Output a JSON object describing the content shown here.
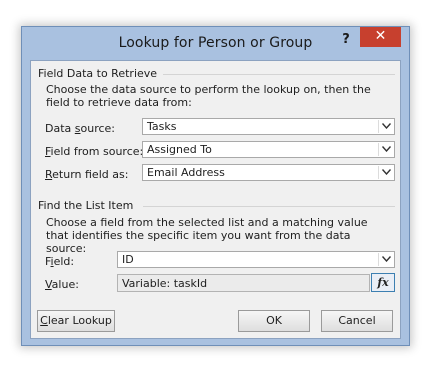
{
  "window": {
    "title": "Lookup for Person or Group",
    "help_label": "?",
    "close_label": "✕"
  },
  "field_data": {
    "section_title": "Field Data to Retrieve",
    "description": "Choose the data source to perform the lookup on, then the field to retrieve data from:",
    "data_source": {
      "label_pre": "Data ",
      "label_u": "s",
      "label_post": "ource:",
      "value": "Tasks"
    },
    "field_from_source": {
      "label_pre": "",
      "label_u": "F",
      "label_post": "ield from source:",
      "value": "Assigned To"
    },
    "return_field_as": {
      "label_pre": "",
      "label_u": "R",
      "label_post": "eturn field as:",
      "value": "Email Address"
    }
  },
  "find_item": {
    "section_title": "Find the List Item",
    "description": "Choose a field from the selected list and a matching value that identifies the specific item you want from the data source:",
    "field": {
      "label_pre": "F",
      "label_u": "i",
      "label_post": "eld:",
      "value": "ID"
    },
    "value": {
      "label_pre": "",
      "label_u": "V",
      "label_post": "alue:",
      "value": "Variable: taskId"
    },
    "fx_label": "fx"
  },
  "buttons": {
    "clear_pre": "",
    "clear_u": "C",
    "clear_post": "lear Lookup",
    "ok": "OK",
    "cancel": "Cancel"
  }
}
